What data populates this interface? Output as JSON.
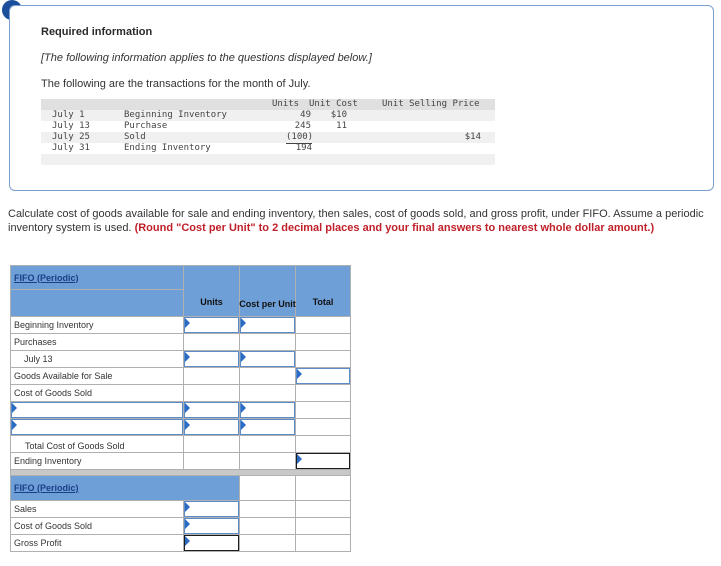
{
  "alert_glyph": "!",
  "info": {
    "title": "Required information",
    "note": "[The following information applies to the questions displayed below.]",
    "intro": "The following are the transactions for the month of July."
  },
  "transactions": {
    "headers": {
      "units": "Units",
      "unit_cost": "Unit Cost",
      "unit_selling_price": "Unit Selling Price"
    },
    "rows": [
      {
        "date": "July 1",
        "desc": "Beginning Inventory",
        "units": "49",
        "unit_cost": "$10",
        "selling_price": ""
      },
      {
        "date": "July 13",
        "desc": "Purchase",
        "units": "245",
        "unit_cost": "11",
        "selling_price": ""
      },
      {
        "date": "July 25",
        "desc": "Sold",
        "units": "(100)",
        "unit_cost": "",
        "selling_price": "$14"
      },
      {
        "date": "July 31",
        "desc": "Ending Inventory",
        "units": "194",
        "unit_cost": "",
        "selling_price": ""
      }
    ]
  },
  "question": {
    "text": "Calculate cost of goods available for sale and ending inventory, then sales, cost of goods sold, and gross profit, under FIFO. Assume a periodic inventory system is used.",
    "emphasis": "(Round \"Cost per Unit\" to 2 decimal places and your final answers to nearest whole dollar amount.)"
  },
  "table": {
    "section1_title": "FIFO (Periodic)",
    "col_units": "Units",
    "col_cost_per_unit": "Cost per Unit",
    "col_total": "Total",
    "rows": {
      "beginning_inventory": "Beginning Inventory",
      "purchases": "Purchases",
      "july13": "July 13",
      "goods_available": "Goods Available for Sale",
      "cogs": "Cost of Goods Sold",
      "total_cogs": "Total Cost of Goods Sold",
      "ending_inventory": "Ending Inventory"
    },
    "section2_title": "FIFO (Periodic)",
    "rows2": {
      "sales": "Sales",
      "cogs": "Cost of Goods Sold",
      "gross_profit": "Gross Profit"
    }
  }
}
